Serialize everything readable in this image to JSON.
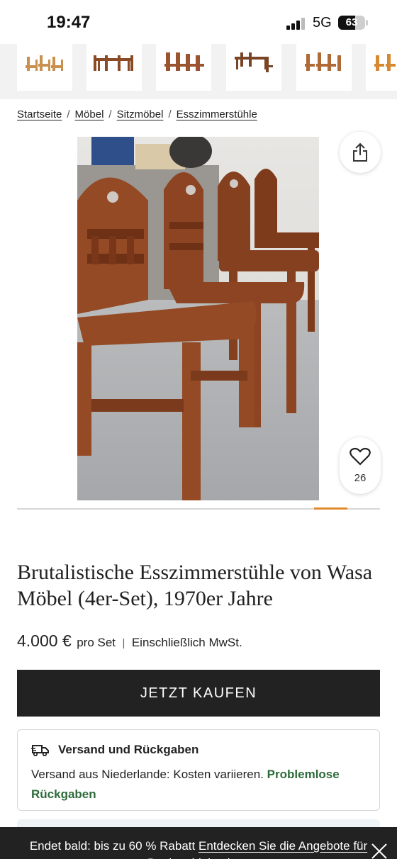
{
  "status_bar": {
    "time": "19:47",
    "network": "5G",
    "battery": "63"
  },
  "thumbnails": [
    {
      "label": "chairs-thumbnail-1"
    },
    {
      "label": "chairs-thumbnail-2"
    },
    {
      "label": "chairs-thumbnail-3"
    },
    {
      "label": "chairs-thumbnail-4"
    },
    {
      "label": "chairs-thumbnail-5"
    },
    {
      "label": "chairs-thumbnail-6"
    }
  ],
  "breadcrumb": {
    "items": [
      "Startseite",
      "Möbel",
      "Sitzmöbel",
      "Esszimmerstühle"
    ],
    "separator": "/"
  },
  "gallery": {
    "favorites_count": "26",
    "share_icon": "share-icon",
    "favorite_icon": "heart-icon"
  },
  "product": {
    "title": "Brutalistische Esszimmerstühle von Wasa Möbel (4er-Set), 1970er Jahre",
    "price": "4.000 €",
    "price_unit": "pro Set",
    "price_divider": "|",
    "tax_note": "Einschließlich MwSt.",
    "buy_label": "JETZT KAUFEN"
  },
  "shipping": {
    "icon": "delivery-truck-icon",
    "title": "Versand und Rückgaben",
    "text": "Versand aus Niederlande: Kosten variieren.",
    "link": "Problemlose Rückgaben"
  },
  "promo": {
    "text": "Endet bald: bis zu 60 % Rabatt",
    "link": "Entdecken Sie die Angebote für Designobjekte jetzt"
  },
  "colors": {
    "accent": "#e08a2e",
    "button_bg": "#222222",
    "link_green": "#2e6b3a",
    "wood": "#8a4321"
  }
}
